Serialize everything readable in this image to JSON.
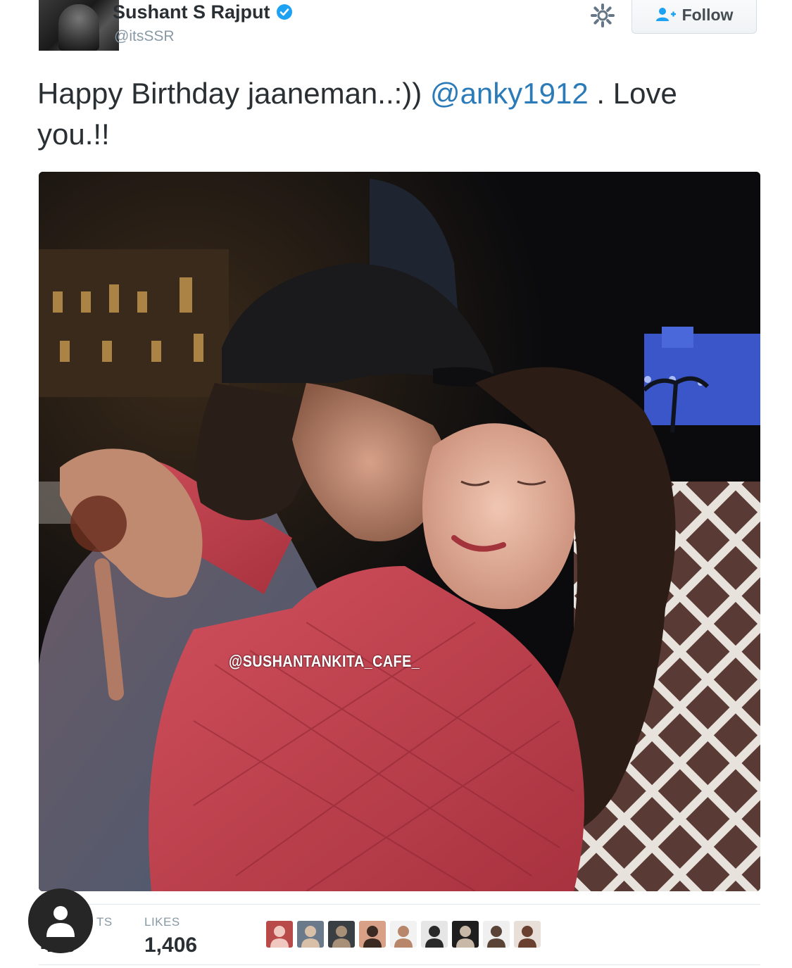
{
  "user": {
    "display_name": "Sushant S Rajput",
    "handle": "@itsSSR"
  },
  "actions": {
    "follow_label": "Follow"
  },
  "tweet": {
    "text_before": "Happy Birthday jaaneman..:)) ",
    "mention": "@anky1912",
    "text_after": " . Love you.!!"
  },
  "photo": {
    "watermark": "@SUSHANTANKITA_CAFE_"
  },
  "stats": {
    "retweets_label": "TS",
    "retweets_value": "430",
    "likes_label": "LIKES",
    "likes_value": "1,406"
  },
  "colors": {
    "link": "#2b7bb9",
    "verified": "#1da1f2",
    "muted": "#8899a6",
    "jacket": "#c0404d"
  },
  "likers": [
    {
      "name": "liker-avatar-1",
      "bg": "#b84a4a",
      "fg": "#f0c8c0"
    },
    {
      "name": "liker-avatar-2",
      "bg": "#6a7a8a",
      "fg": "#d8c0a8"
    },
    {
      "name": "liker-avatar-3",
      "bg": "#3a3f44",
      "fg": "#a89078"
    },
    {
      "name": "liker-avatar-4",
      "bg": "#d9a088",
      "fg": "#3a2a22"
    },
    {
      "name": "liker-avatar-5",
      "bg": "#f2f2f2",
      "fg": "#b8866a"
    },
    {
      "name": "liker-avatar-6",
      "bg": "#e6e6e6",
      "fg": "#2a2a2a"
    },
    {
      "name": "liker-avatar-7",
      "bg": "#1e1e1e",
      "fg": "#c8b8a8"
    },
    {
      "name": "liker-avatar-8",
      "bg": "#efefef",
      "fg": "#5a4438"
    },
    {
      "name": "liker-avatar-9",
      "bg": "#e8e0d8",
      "fg": "#6a4030"
    }
  ]
}
